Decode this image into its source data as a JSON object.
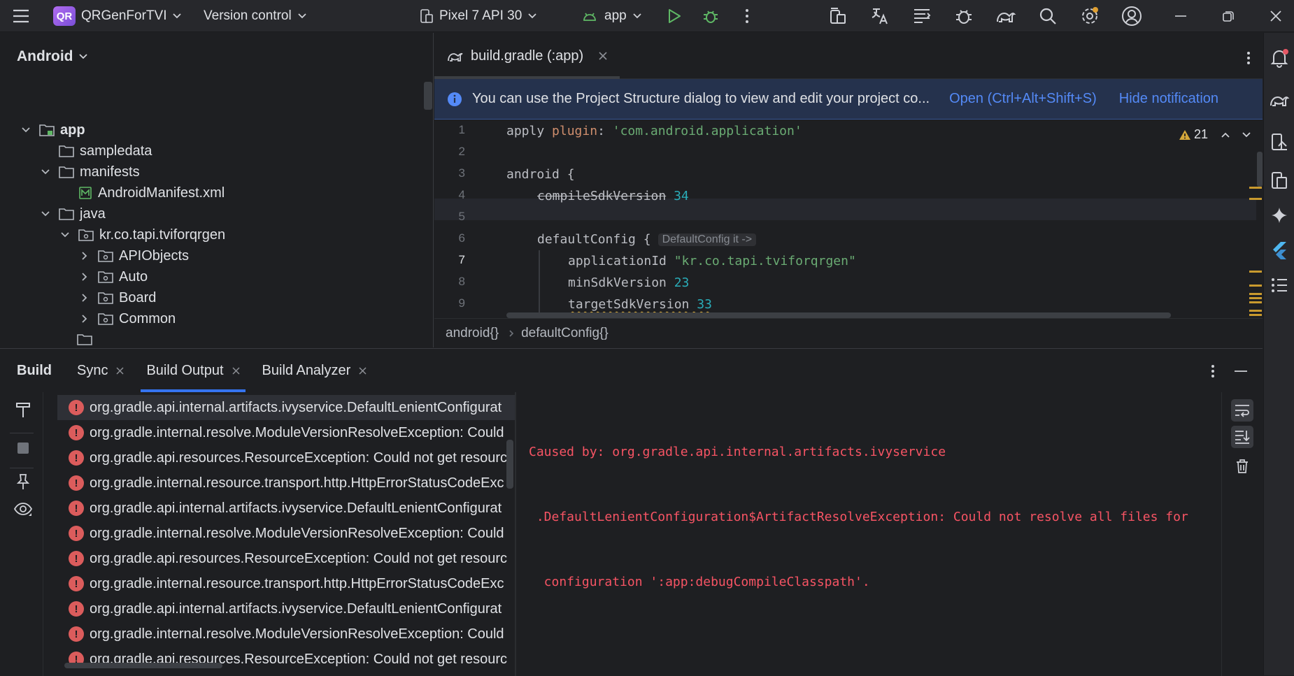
{
  "titlebar": {
    "project_badge": "QR",
    "project_name": "QRGenForTVI",
    "vcs": "Version control",
    "device": "Pixel 7 API 30",
    "run_config": "app"
  },
  "project_panel": {
    "view": "Android",
    "tree": [
      {
        "label": "app",
        "depth": 0,
        "expanded": true,
        "kind": "module"
      },
      {
        "label": "sampledata",
        "depth": 1,
        "expanded": null,
        "kind": "folder"
      },
      {
        "label": "manifests",
        "depth": 1,
        "expanded": true,
        "kind": "folder"
      },
      {
        "label": "AndroidManifest.xml",
        "depth": 2,
        "expanded": null,
        "kind": "manifest"
      },
      {
        "label": "java",
        "depth": 1,
        "expanded": true,
        "kind": "folder"
      },
      {
        "label": "kr.co.tapi.tviforqrgen",
        "depth": 2,
        "expanded": true,
        "kind": "package"
      },
      {
        "label": "APIObjects",
        "depth": 3,
        "expanded": false,
        "kind": "package"
      },
      {
        "label": "Auto",
        "depth": 3,
        "expanded": false,
        "kind": "package"
      },
      {
        "label": "Board",
        "depth": 3,
        "expanded": false,
        "kind": "package"
      },
      {
        "label": "Common",
        "depth": 3,
        "expanded": false,
        "kind": "package"
      }
    ]
  },
  "editor": {
    "tab_label": "build.gradle (:app)",
    "notification": {
      "text": "You can use the Project Structure dialog to view and edit your project co...",
      "action_open": "Open (Ctrl+Alt+Shift+S)",
      "action_hide": "Hide notification"
    },
    "warning_count": "21",
    "line_numbers": [
      "1",
      "2",
      "3",
      "4",
      "5",
      "6",
      "7",
      "8",
      "9"
    ],
    "current_line": "7",
    "code": {
      "l1_a": "apply ",
      "l1_b": "plugin",
      "l1_c": ": ",
      "l1_d": "'com.android.application'",
      "l3": "android {",
      "l4_a": "compileSdkVersion",
      "l4_b": "34",
      "l6_a": "defaultConfig {",
      "l6_hint": "DefaultConfig it ->",
      "l7_a": "applicationId ",
      "l7_b": "\"kr.co.tapi.tviforqrgen\"",
      "l8_a": "minSdkVersion ",
      "l8_b": "23",
      "l9_a": "targetSdkVersion",
      "l9_b": "33"
    },
    "breadcrumbs": [
      "android{}",
      "defaultConfig{}"
    ]
  },
  "build_panel": {
    "title": "Build",
    "tabs": [
      {
        "label": "Sync",
        "closable": true,
        "active": false
      },
      {
        "label": "Build Output",
        "closable": true,
        "active": true
      },
      {
        "label": "Build Analyzer",
        "closable": true,
        "active": false
      }
    ],
    "errors": [
      "org.gradle.api.internal.artifacts.ivyservice.DefaultLenientConfigurat",
      "org.gradle.internal.resolve.ModuleVersionResolveException: Could",
      "org.gradle.api.resources.ResourceException: Could not get resourc",
      "org.gradle.internal.resource.transport.http.HttpErrorStatusCodeExc",
      "org.gradle.api.internal.artifacts.ivyservice.DefaultLenientConfigurat",
      "org.gradle.internal.resolve.ModuleVersionResolveException: Could",
      "org.gradle.api.resources.ResourceException: Could not get resourc",
      "org.gradle.internal.resource.transport.http.HttpErrorStatusCodeExc",
      "org.gradle.api.internal.artifacts.ivyservice.DefaultLenientConfigurat",
      "org.gradle.internal.resolve.ModuleVersionResolveException: Could",
      "org.gradle.api.resources.ResourceException: Could not get resourc"
    ],
    "console_lines": [
      "Caused by: org.gradle.api.internal.artifacts.ivyservice",
      " .DefaultLenientConfiguration$ArtifactResolveException: Could not resolve all files for",
      "  configuration ':app:debugCompileClasspath'."
    ]
  },
  "colors": {
    "background": "#1e1f22",
    "accent": "#3574f0",
    "error": "#db5c5c",
    "console_error": "#f75464",
    "warning": "#d4a73a",
    "run_green": "#5fb865"
  }
}
